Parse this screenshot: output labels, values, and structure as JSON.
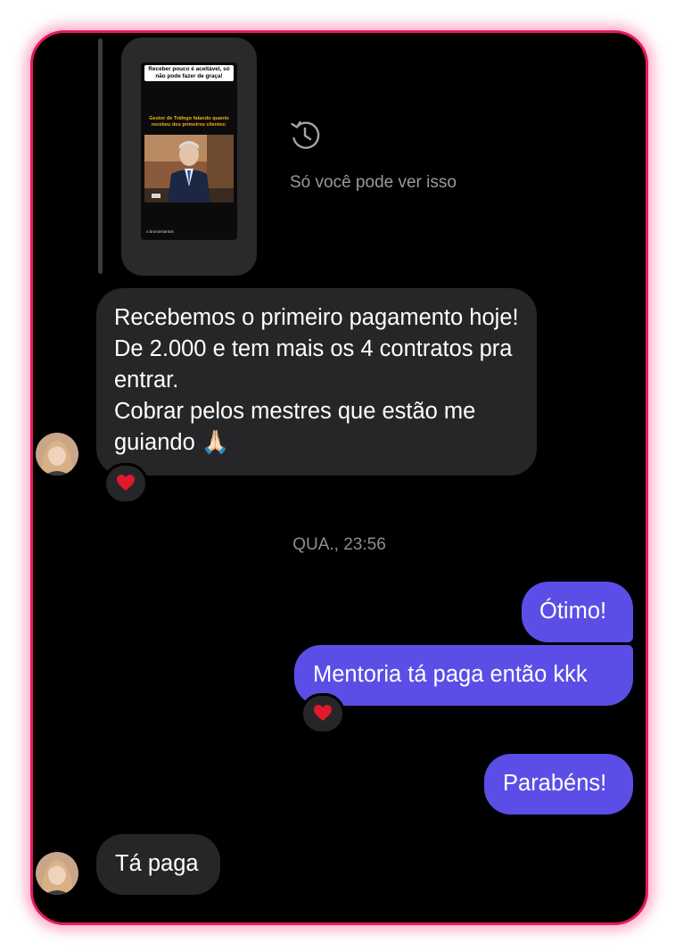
{
  "story": {
    "headline": "Receber pouco é aceitável, só não pode fazer de graça!",
    "caption": "Gestor de Tráfego falando quanto recebeu dos primeiros clientes:",
    "handle": "o.brunossantos"
  },
  "story_notice": "Só você pode ver isso",
  "messages": [
    {
      "from": "contact",
      "text": "Recebemos o primeiro pagamento hoje! De 2.000 e tem mais os 4 contratos pra entrar.\nCobrar pelos mestres que estão me guiando 🙏🏻",
      "reaction": "heart"
    },
    {
      "from": "me",
      "text": "Ótimo!"
    },
    {
      "from": "me",
      "text": "Mentoria tá paga então kkk",
      "reaction": "heart"
    },
    {
      "from": "me",
      "text": "Parabéns!"
    },
    {
      "from": "contact",
      "text": "Tá paga"
    }
  ],
  "timestamp": "QUA., 23:56",
  "colors": {
    "outgoing_bubble": "#5b4ee6",
    "incoming_bubble": "#262628",
    "frame_border": "#e6195e",
    "reaction_heart": "#e0192d"
  },
  "icons": {
    "history": "history-clock-icon",
    "reaction": "heart-reaction-icon",
    "emoji": "folded-hands-emoji"
  }
}
